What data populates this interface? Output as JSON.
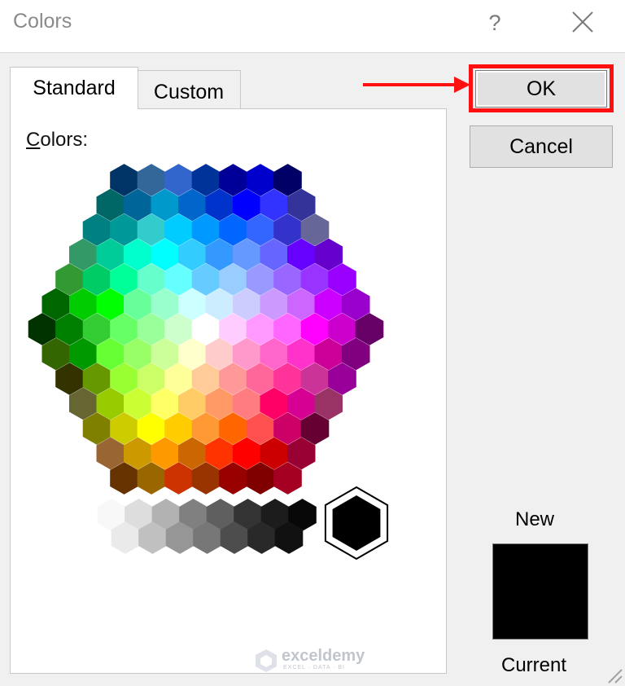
{
  "dialog": {
    "title": "Colors",
    "help_glyph": "?"
  },
  "tabs": [
    {
      "label": "Standard",
      "selected": true
    },
    {
      "label": "Custom",
      "selected": false
    }
  ],
  "panel": {
    "colors_label_accel": "C",
    "colors_label_rest": "olors:"
  },
  "buttons": {
    "ok": "OK",
    "cancel": "Cancel"
  },
  "preview": {
    "new_label": "New",
    "current_label": "Current",
    "color": "#000000"
  },
  "annotation": {
    "color": "#ff1010"
  },
  "watermark": {
    "name": "exceldemy",
    "tagline": "EXCEL · DATA · BI"
  },
  "palette": {
    "selected": "#000000",
    "rows": [
      [
        "#003366",
        "#336699",
        "#3366cc",
        "#003399",
        "#000099",
        "#0000cc",
        "#000066"
      ],
      [
        "#006666",
        "#006699",
        "#0099cc",
        "#0066cc",
        "#0033cc",
        "#0000ff",
        "#3333ff",
        "#333399"
      ],
      [
        "#008080",
        "#009999",
        "#33cccc",
        "#00ccff",
        "#0099ff",
        "#0066ff",
        "#3366ff",
        "#3333cc",
        "#666699"
      ],
      [
        "#339966",
        "#00cc99",
        "#00ffcc",
        "#00ffff",
        "#33ccff",
        "#3399ff",
        "#6699ff",
        "#6666ff",
        "#6600ff",
        "#6600cc"
      ],
      [
        "#339933",
        "#00cc66",
        "#00ff99",
        "#66ffcc",
        "#66ffff",
        "#66ccff",
        "#99ccff",
        "#9999ff",
        "#9966ff",
        "#9933ff",
        "#9900ff"
      ],
      [
        "#006600",
        "#00cc00",
        "#00ff00",
        "#66ff99",
        "#99ffcc",
        "#ccffff",
        "#ccecff",
        "#ccccff",
        "#cc99ff",
        "#cc66ff",
        "#cc00ff",
        "#9900cc"
      ],
      [
        "#003300",
        "#008000",
        "#33cc33",
        "#66ff66",
        "#99ff99",
        "#ccffcc",
        "#ffffff",
        "#ffccff",
        "#ff99ff",
        "#ff66ff",
        "#ff00ff",
        "#cc00cc",
        "#660066"
      ],
      [
        "#336600",
        "#009900",
        "#66ff33",
        "#99ff66",
        "#ccff99",
        "#ffffcc",
        "#ffcccc",
        "#ff99cc",
        "#ff66cc",
        "#ff33cc",
        "#cc0099",
        "#800080"
      ],
      [
        "#333300",
        "#669900",
        "#99ff33",
        "#ccff66",
        "#ffff99",
        "#ffcc99",
        "#ff9999",
        "#ff6699",
        "#ff3399",
        "#cc3399",
        "#990099"
      ],
      [
        "#666633",
        "#99cc00",
        "#ccff33",
        "#ffff66",
        "#ffcc66",
        "#ff9966",
        "#ff7c80",
        "#ff0066",
        "#d60093",
        "#993366"
      ],
      [
        "#808000",
        "#cccc00",
        "#ffff00",
        "#ffcc00",
        "#ff9933",
        "#ff6600",
        "#ff5050",
        "#cc0066",
        "#660033"
      ],
      [
        "#996633",
        "#cc9900",
        "#ff9900",
        "#cc6600",
        "#ff3300",
        "#ff0000",
        "#cc0000",
        "#990033"
      ],
      [
        "#663300",
        "#996600",
        "#cc3300",
        "#993300",
        "#990000",
        "#800000",
        "#a50021"
      ]
    ],
    "grays_top": [
      "#f8f8f8",
      "#dddddd",
      "#b2b2b2",
      "#808080",
      "#5f5f5f",
      "#333333",
      "#1c1c1c",
      "#080808"
    ],
    "grays_bottom": [
      "#eaeaea",
      "#c0c0c0",
      "#969696",
      "#777777",
      "#4d4d4d",
      "#292929",
      "#111111"
    ]
  }
}
